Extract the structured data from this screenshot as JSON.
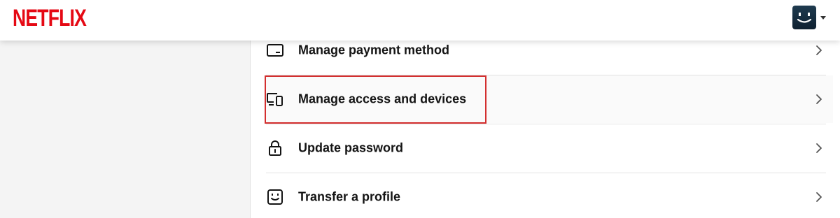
{
  "brand": {
    "logo_text": "NETFLIX",
    "color": "#E50914"
  },
  "header": {
    "avatar_icon": "smiley-profile-icon",
    "menu_icon": "caret-down-icon"
  },
  "menu": {
    "items": [
      {
        "label": "Manage payment method",
        "icon": "credit-card-icon"
      },
      {
        "label": "Manage access and devices",
        "icon": "devices-icon"
      },
      {
        "label": "Update password",
        "icon": "lock-icon"
      },
      {
        "label": "Transfer a profile",
        "icon": "profile-transfer-icon"
      }
    ],
    "chevron_icon": "chevron-right-icon",
    "highlighted_item": "Manage access and devices",
    "highlight_color": "#D32F2F"
  }
}
